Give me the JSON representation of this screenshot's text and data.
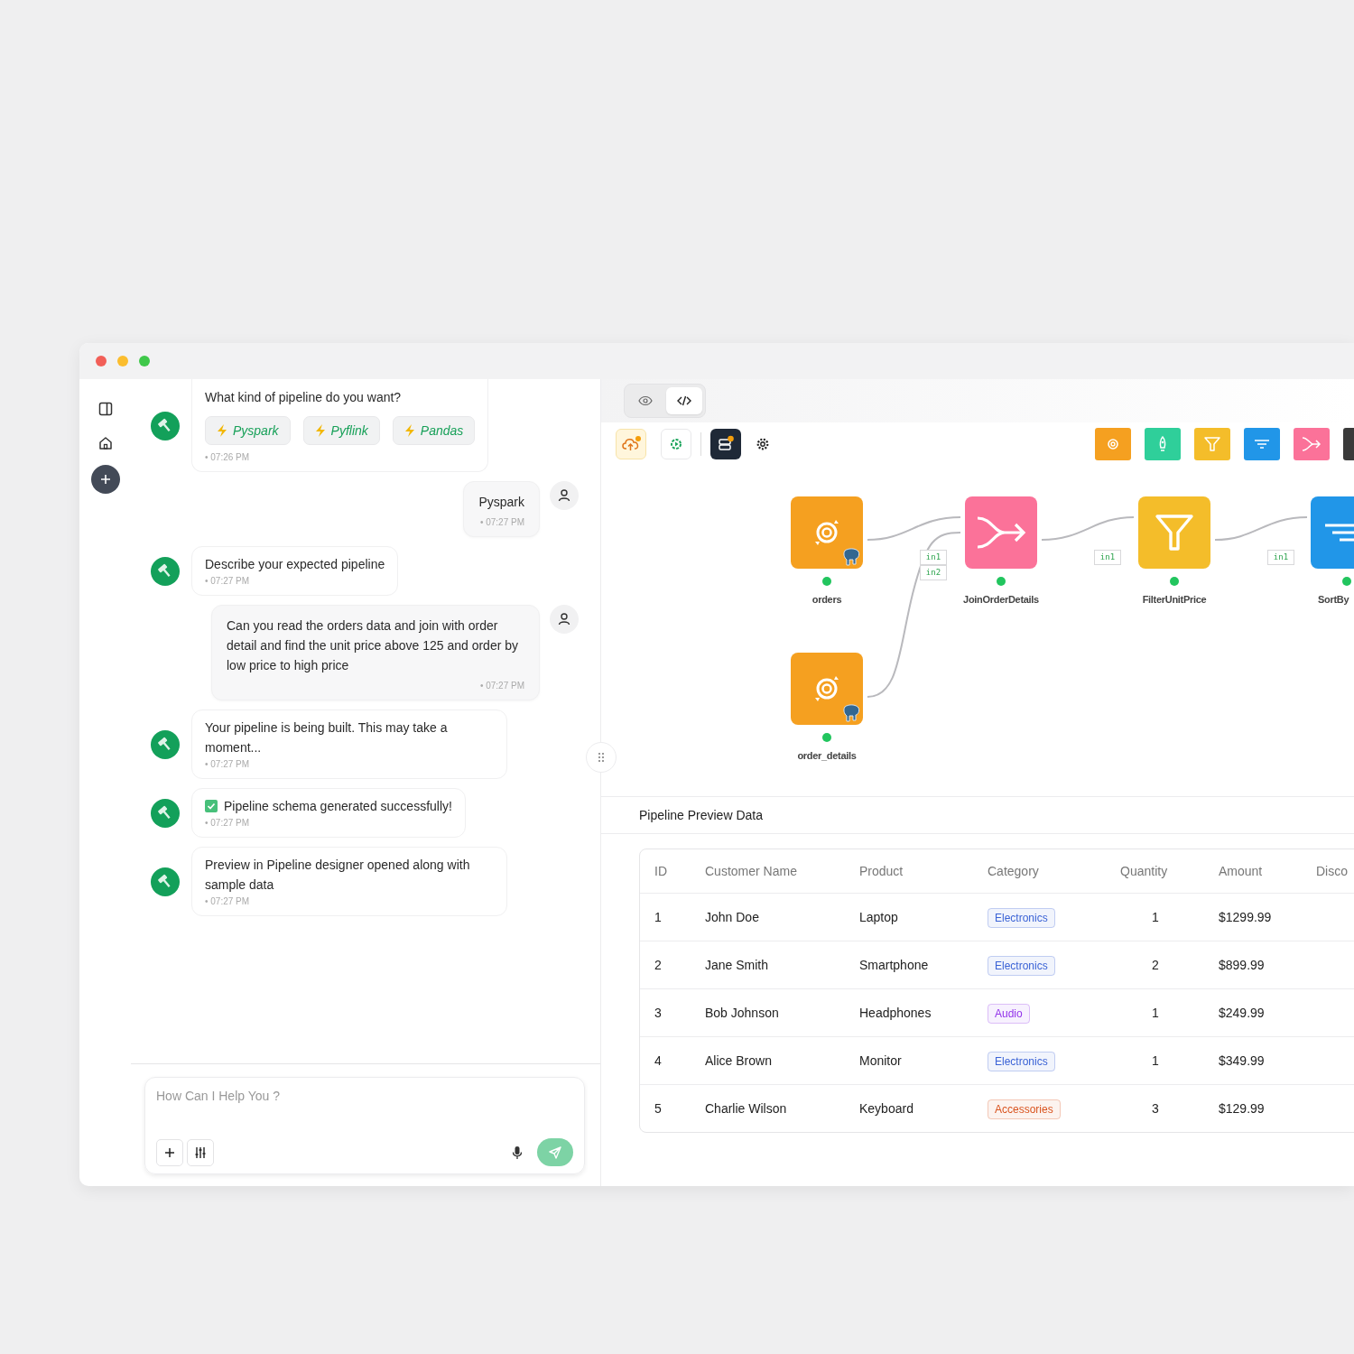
{
  "chat": {
    "messages": [
      {
        "kind": "bot",
        "text": "What kind of pipeline do you want?",
        "options": [
          "Pyspark",
          "Pyflink",
          "Pandas"
        ],
        "time": "• 07:26 PM"
      },
      {
        "kind": "user",
        "text": "Pyspark",
        "time": "• 07:27 PM"
      },
      {
        "kind": "bot",
        "text": "Describe your expected pipeline",
        "time": "• 07:27 PM"
      },
      {
        "kind": "user",
        "text": "Can you read the orders data and join with order detail and find the unit price above 125 and order by low price to high price",
        "time": "• 07:27 PM"
      },
      {
        "kind": "bot",
        "text": "Your pipeline is being built. This may take a moment...",
        "time": "• 07:27 PM"
      },
      {
        "kind": "bot_success",
        "text": "Pipeline schema generated successfully!",
        "time": "• 07:27 PM"
      },
      {
        "kind": "bot",
        "text": "Preview in Pipeline designer opened along with sample data",
        "time": "• 07:27 PM"
      }
    ],
    "composer": {
      "placeholder": "How Can I Help You ?"
    }
  },
  "designer": {
    "view_tabs": [
      {
        "kind": "preview",
        "selected": false
      },
      {
        "kind": "code",
        "selected": true
      }
    ],
    "nodes": [
      {
        "kind": "source",
        "label": "orders"
      },
      {
        "kind": "join",
        "label": "JoinOrderDetails"
      },
      {
        "kind": "filter",
        "label": "FilterUnitPrice"
      },
      {
        "kind": "sort",
        "label": "SortBy"
      },
      {
        "kind": "source",
        "label": "order_details"
      }
    ],
    "edges": [
      {
        "label": "in1"
      },
      {
        "label": "in2"
      },
      {
        "label": "in1"
      },
      {
        "label": "in1"
      }
    ]
  },
  "preview": {
    "title": "Pipeline Preview Data",
    "columns": [
      "ID",
      "Customer Name",
      "Product",
      "Category",
      "Quantity",
      "Amount",
      "Disco"
    ],
    "rows": [
      {
        "id": "1",
        "customer": "John Doe",
        "product": "Laptop",
        "category": {
          "text": "Electronics",
          "color": "#3b63d6"
        },
        "quantity": "1",
        "amount": "$1299.99"
      },
      {
        "id": "2",
        "customer": "Jane Smith",
        "product": "Smartphone",
        "category": {
          "text": "Electronics",
          "color": "#3b63d6"
        },
        "quantity": "2",
        "amount": "$899.99"
      },
      {
        "id": "3",
        "customer": "Bob Johnson",
        "product": "Headphones",
        "category": {
          "text": "Audio",
          "color": "#9333ea"
        },
        "quantity": "1",
        "amount": "$249.99"
      },
      {
        "id": "4",
        "customer": "Alice Brown",
        "product": "Monitor",
        "category": {
          "text": "Electronics",
          "color": "#3b63d6"
        },
        "quantity": "1",
        "amount": "$349.99"
      },
      {
        "id": "5",
        "customer": "Charlie Wilson",
        "product": "Keyboard",
        "category": {
          "text": "Accessories",
          "color": "#d9531e"
        },
        "quantity": "3",
        "amount": "$129.99"
      }
    ]
  }
}
